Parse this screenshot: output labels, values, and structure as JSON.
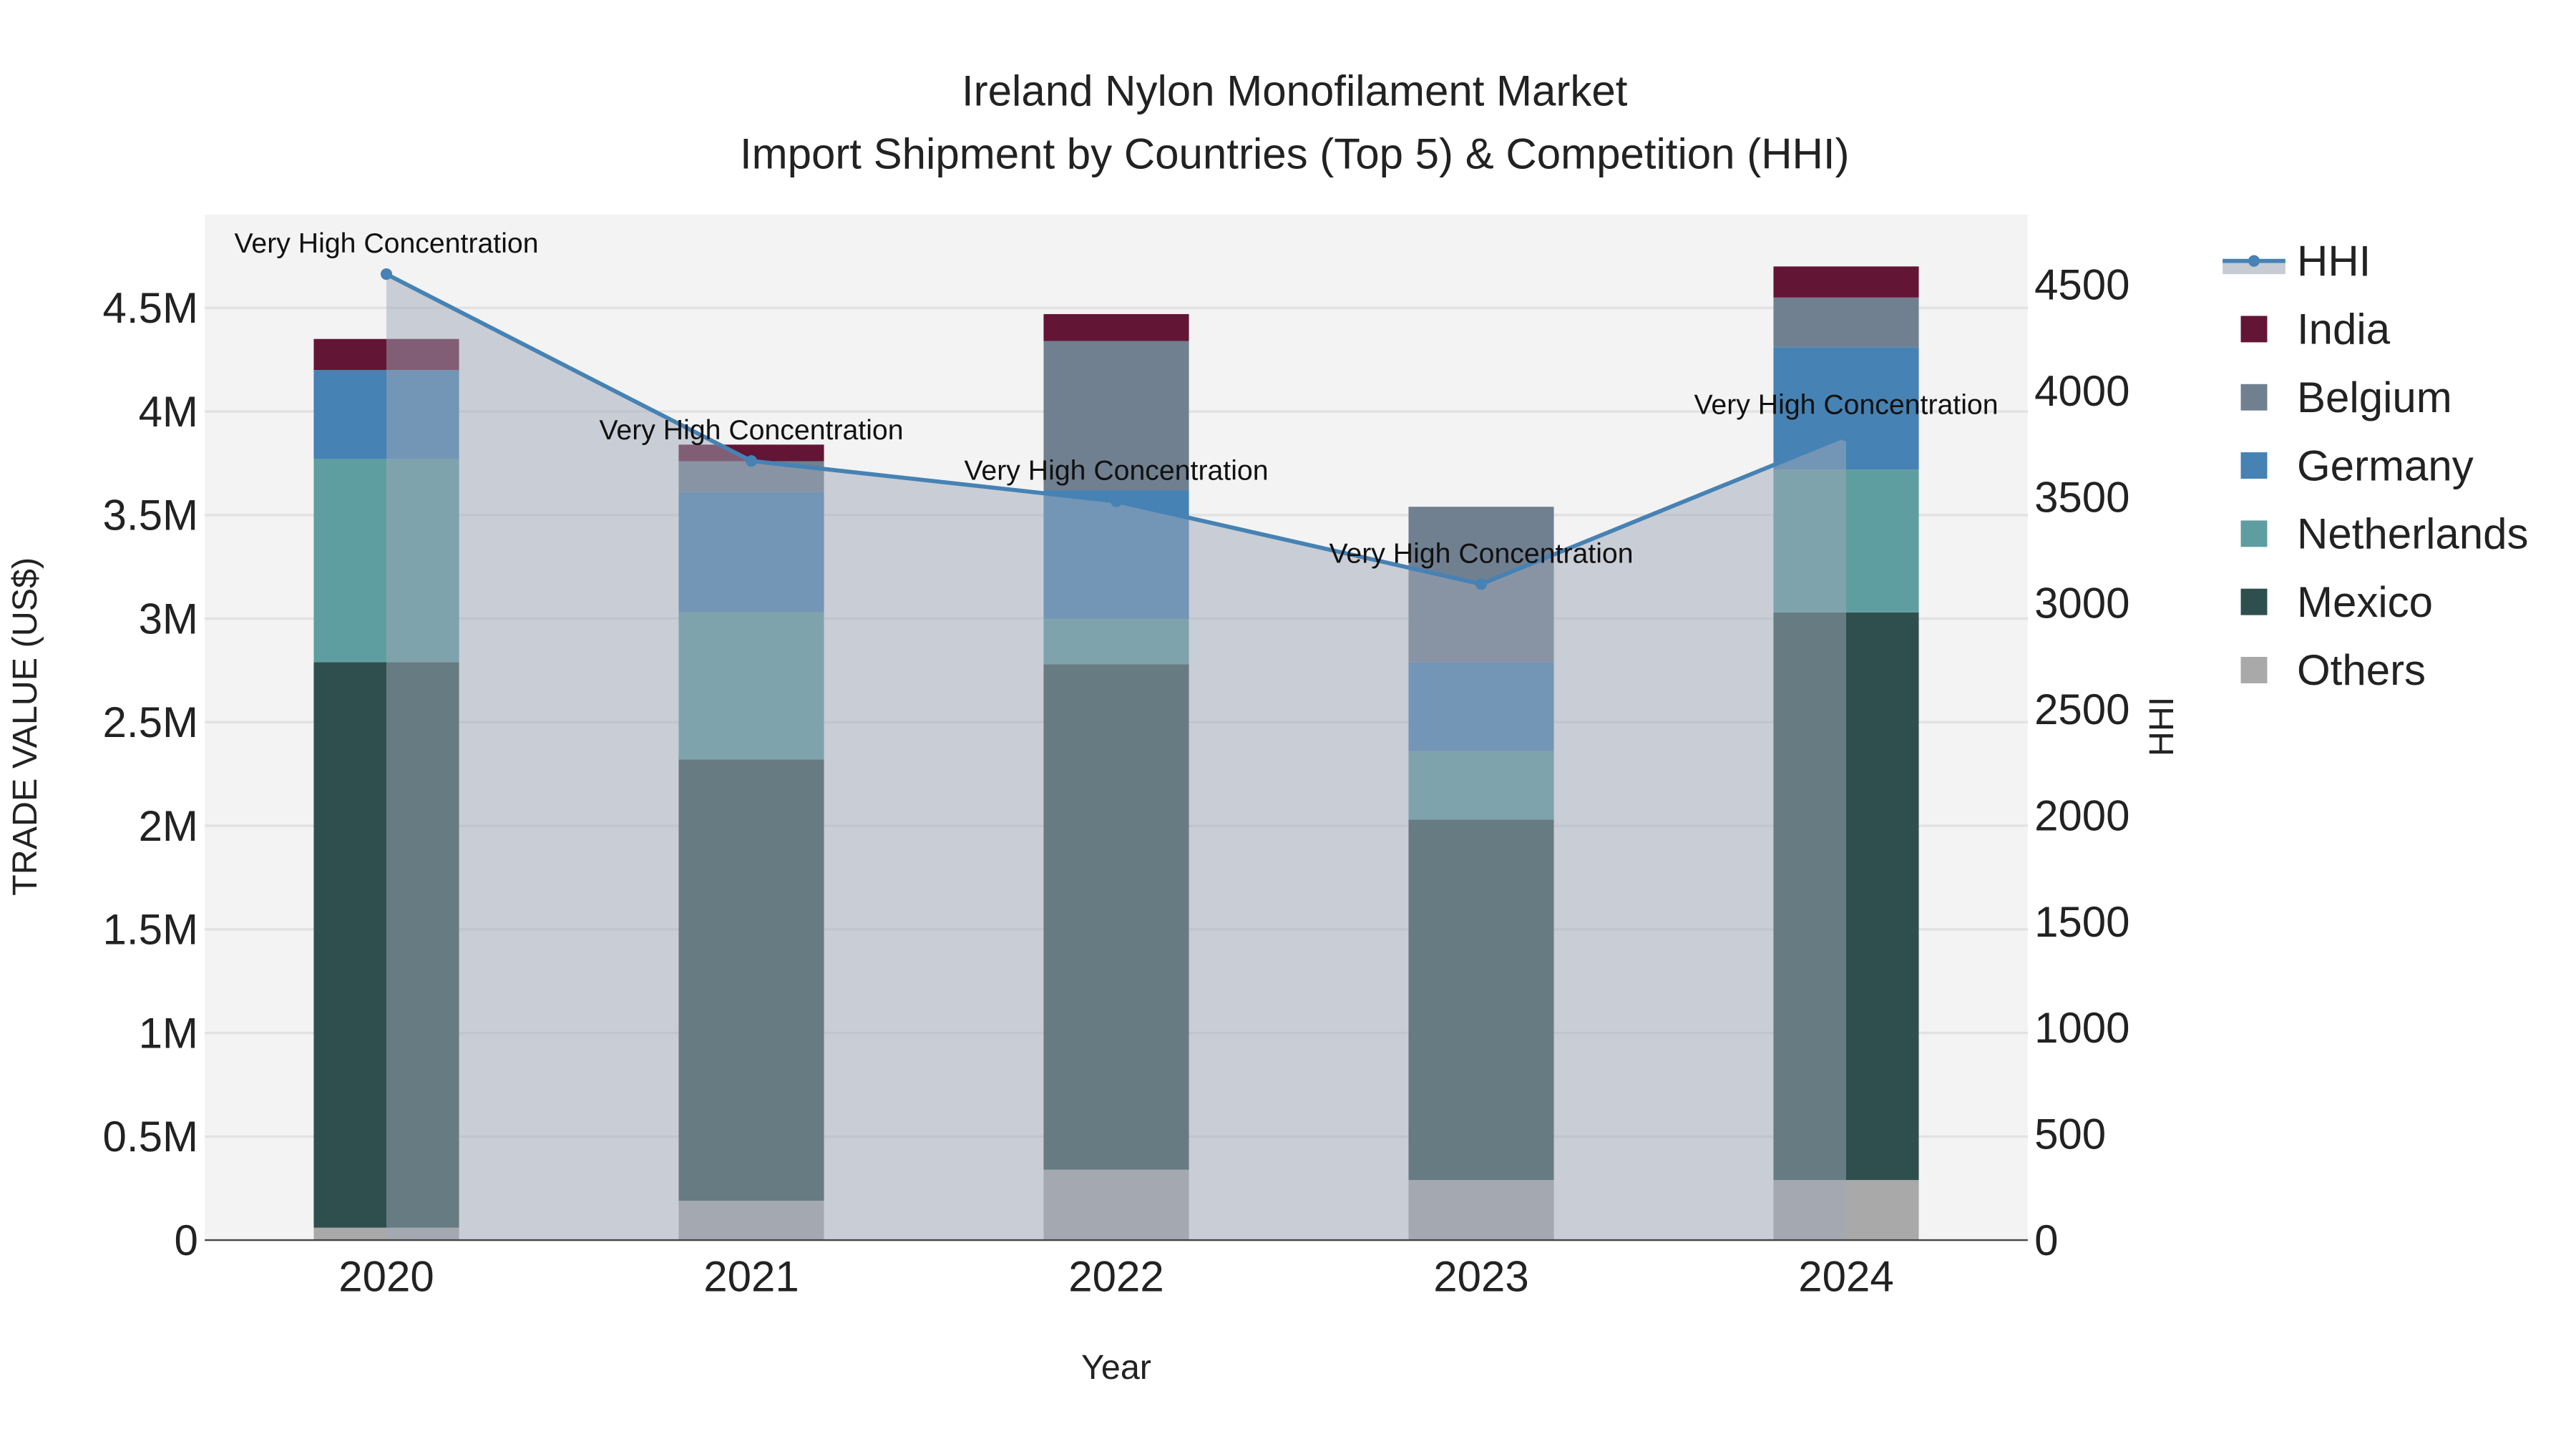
{
  "chart_data": {
    "type": "bar",
    "title_line1": "Ireland Nylon Monofilament Market",
    "title_line2": "Import Shipment by Countries (Top 5) & Competition (HHI)",
    "xlabel": "Year",
    "ylabel": "TRADE VALUE (US$)",
    "y2label": "HHI",
    "categories": [
      "2020",
      "2021",
      "2022",
      "2023",
      "2024"
    ],
    "ylim": [
      0,
      4950000
    ],
    "y2lim": [
      0,
      4830
    ],
    "yticks": [
      0,
      500000,
      1000000,
      1500000,
      2000000,
      2500000,
      3000000,
      3500000,
      4000000,
      4500000
    ],
    "ytick_labels": [
      "0",
      "0.5M",
      "1M",
      "1.5M",
      "2M",
      "2.5M",
      "3M",
      "3.5M",
      "4M",
      "4.5M"
    ],
    "y2ticks": [
      0,
      500,
      1000,
      1500,
      2000,
      2500,
      3000,
      3500,
      4000,
      4500
    ],
    "y2tick_labels": [
      "0",
      "500",
      "1000",
      "1500",
      "2000",
      "2500",
      "3000",
      "3500",
      "4000",
      "4500"
    ],
    "series": [
      {
        "name": "Others",
        "color": "#a9a9a9",
        "values": [
          60000,
          190000,
          340000,
          290000,
          290000
        ]
      },
      {
        "name": "Mexico",
        "color": "#2f4f4f",
        "values": [
          2730000,
          2130000,
          2440000,
          1740000,
          2740000
        ]
      },
      {
        "name": "Netherlands",
        "color": "#5f9ea0",
        "values": [
          980000,
          710000,
          220000,
          330000,
          690000
        ]
      },
      {
        "name": "Germany",
        "color": "#4682b4",
        "values": [
          430000,
          580000,
          620000,
          430000,
          590000
        ]
      },
      {
        "name": "Belgium",
        "color": "#708090",
        "values": [
          0,
          150000,
          720000,
          750000,
          240000
        ]
      },
      {
        "name": "India",
        "color": "#631535",
        "values": [
          150000,
          80000,
          130000,
          0,
          150000
        ]
      }
    ],
    "hhi": {
      "name": "HHI",
      "color": "#4682b4",
      "values": [
        4550,
        3670,
        3480,
        3090,
        3790
      ],
      "annotations": [
        "Very High Concentration",
        "Very High Concentration",
        "Very High Concentration",
        "Very High Concentration",
        "Very High Concentration"
      ]
    },
    "legend": [
      "HHI",
      "India",
      "Belgium",
      "Germany",
      "Netherlands",
      "Mexico",
      "Others"
    ],
    "legend_placement": "right",
    "grid": true
  }
}
